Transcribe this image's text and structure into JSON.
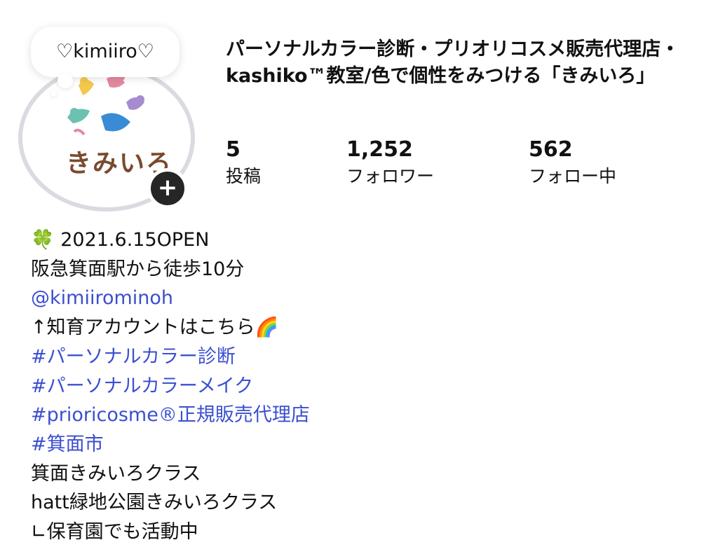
{
  "profile": {
    "note": "♡kimiiro♡",
    "logo_text": "きみいろ",
    "add_symbol": "+",
    "display_name": "パーソナルカラー診断・プリオリコスメ販売代理店・kashiko™教室/色で個性をみつける「きみいろ」"
  },
  "stats": [
    {
      "value": "5",
      "label": "投稿"
    },
    {
      "value": "1,252",
      "label": "フォロワー"
    },
    {
      "value": "562",
      "label": "フォロー中"
    }
  ],
  "bio": {
    "clover_icon": "🍀",
    "line1": "2021.6.15OPEN",
    "line2": "阪急箕面駅から徒歩10分",
    "mention": "@kimiirominoh",
    "line4": "↑知育アカウントはこちら",
    "rainbow_icon": "🌈",
    "tag1": "#パーソナルカラー診断",
    "tag2": "#パーソナルカラーメイク",
    "tag3": "#prioricosme®正規販売代理店",
    "tag4": "#箕面市",
    "line9": "箕面きみいろクラス",
    "line10": "hatt緑地公園きみいろクラス",
    "line11": "∟保育園でも活動中"
  },
  "colors": {
    "link": "#3b4fd0",
    "ring": "#d9dbe0",
    "logo_text": "#7a4a2e"
  }
}
